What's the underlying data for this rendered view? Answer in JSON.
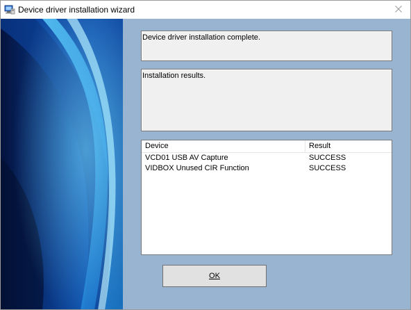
{
  "window": {
    "title": "Device driver installation wizard",
    "close_icon": "close-icon"
  },
  "status": {
    "message": "Device driver installation complete."
  },
  "results": {
    "label": "Installation results."
  },
  "table": {
    "columns": [
      "Device",
      "Result"
    ],
    "rows": [
      {
        "device": "VCD01 USB AV Capture",
        "result": "SUCCESS"
      },
      {
        "device": "VIDBOX Unused CIR Function",
        "result": "SUCCESS"
      }
    ]
  },
  "buttons": {
    "ok_label": "OK"
  },
  "colors": {
    "client_bg": "#99b4d1",
    "panel_bg": "#f0f0f0",
    "button_bg": "#e1e1e1"
  }
}
